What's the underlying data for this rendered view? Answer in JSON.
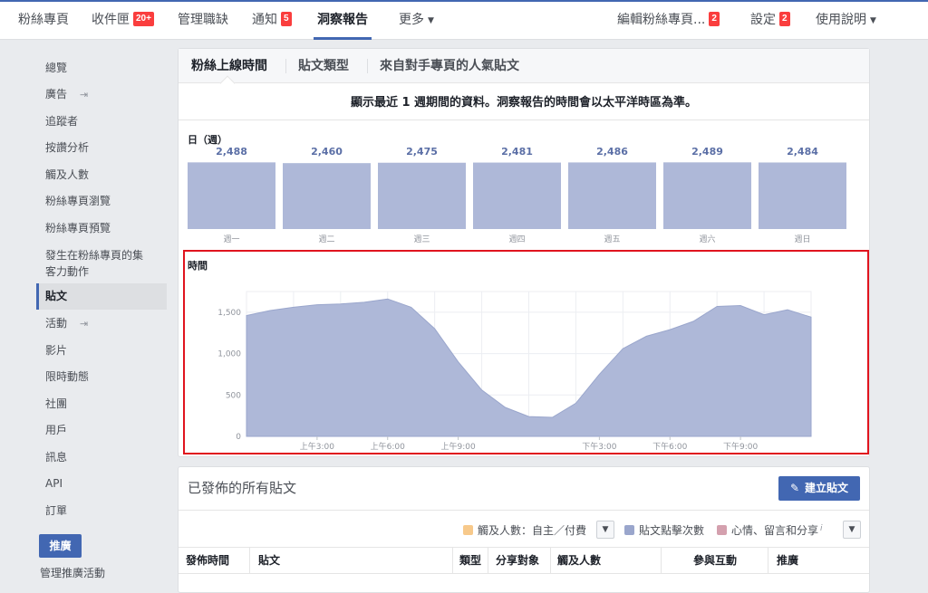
{
  "topnav": {
    "items": [
      {
        "label": "粉絲專頁",
        "badge": ""
      },
      {
        "label": "收件匣",
        "badge": "20+"
      },
      {
        "label": "管理職缺",
        "badge": ""
      },
      {
        "label": "通知",
        "badge": "5"
      },
      {
        "label": "洞察報告",
        "badge": "",
        "active": true
      },
      {
        "label": "更多",
        "badge": ""
      }
    ],
    "right": [
      {
        "label": "編輯粉絲專頁...",
        "badge": "2"
      },
      {
        "label": "設定",
        "badge": "2"
      },
      {
        "label": "使用說明",
        "badge": ""
      }
    ]
  },
  "sidebar": {
    "items": [
      {
        "label": "總覽"
      },
      {
        "label": "廣告"
      },
      {
        "label": "追蹤者"
      },
      {
        "label": "按讚分析"
      },
      {
        "label": "觸及人數"
      },
      {
        "label": "粉絲專頁瀏覽"
      },
      {
        "label": "粉絲專頁預覽"
      },
      {
        "label": "發生在粉絲專頁的集客力動作"
      },
      {
        "label": "貼文"
      },
      {
        "label": "活動"
      },
      {
        "label": "影片"
      },
      {
        "label": "限時動態"
      },
      {
        "label": "社團"
      },
      {
        "label": "用戶"
      },
      {
        "label": "訊息"
      },
      {
        "label": "API"
      },
      {
        "label": "訂單"
      }
    ],
    "promote_label": "推廣",
    "manage_promotions_label": "管理推廣活動"
  },
  "tabs": [
    {
      "label": "粉絲上線時間"
    },
    {
      "label": "貼文類型"
    },
    {
      "label": "來自對手專頁的人氣貼文"
    }
  ],
  "notice": "顯示最近 1 週期間的資料。洞察報告的時間會以太平洋時區為準。",
  "day_section_label": "日（週）",
  "time_section_label": "時間",
  "chart_data": [
    {
      "type": "bar",
      "title": "日（週）",
      "categories": [
        "週一",
        "週二",
        "週三",
        "週四",
        "週五",
        "週六",
        "週日"
      ],
      "values": [
        2488,
        2460,
        2475,
        2481,
        2486,
        2489,
        2484
      ],
      "value_labels": [
        "2,488",
        "2,460",
        "2,475",
        "2,481",
        "2,486",
        "2,489",
        "2,484"
      ],
      "color": "#aeb8d8",
      "label_color": "#5b6fa6"
    },
    {
      "type": "area",
      "title": "時間",
      "x": [
        0,
        1,
        2,
        3,
        4,
        5,
        6,
        7,
        8,
        9,
        10,
        11,
        12,
        13,
        14,
        15,
        16,
        17,
        18,
        19,
        20,
        21,
        22,
        23,
        24
      ],
      "values": [
        1460,
        1520,
        1560,
        1590,
        1600,
        1620,
        1660,
        1560,
        1300,
        900,
        560,
        350,
        240,
        230,
        400,
        750,
        1060,
        1210,
        1290,
        1390,
        1570,
        1580,
        1470,
        1530,
        1440
      ],
      "ylim": [
        0,
        1750
      ],
      "yticks": [
        0,
        500,
        1000,
        1500
      ],
      "ytick_labels": [
        "0",
        "500",
        "1,000",
        "1,500"
      ],
      "xtick_positions": [
        3,
        6,
        9,
        15,
        18,
        21
      ],
      "xtick_labels": [
        "上午3:00",
        "上午6:00",
        "上午9:00",
        "下午3:00",
        "下午6:00",
        "下午9:00"
      ],
      "grid": true,
      "color": "#aeb8d8"
    }
  ],
  "posts": {
    "title": "已發佈的所有貼文",
    "create_label": "建立貼文",
    "legend": [
      {
        "label": "觸及人數：自主／付費",
        "color": "#f7c98b"
      },
      {
        "label": "貼文點擊次數",
        "color": "#9aa6cc"
      },
      {
        "label": "心情、留言和分享",
        "color": "#d4a0ae"
      }
    ],
    "columns": [
      "發佈時間",
      "貼文",
      "類型",
      "分享對象",
      "觸及人數",
      "參與互動",
      "推廣"
    ]
  }
}
